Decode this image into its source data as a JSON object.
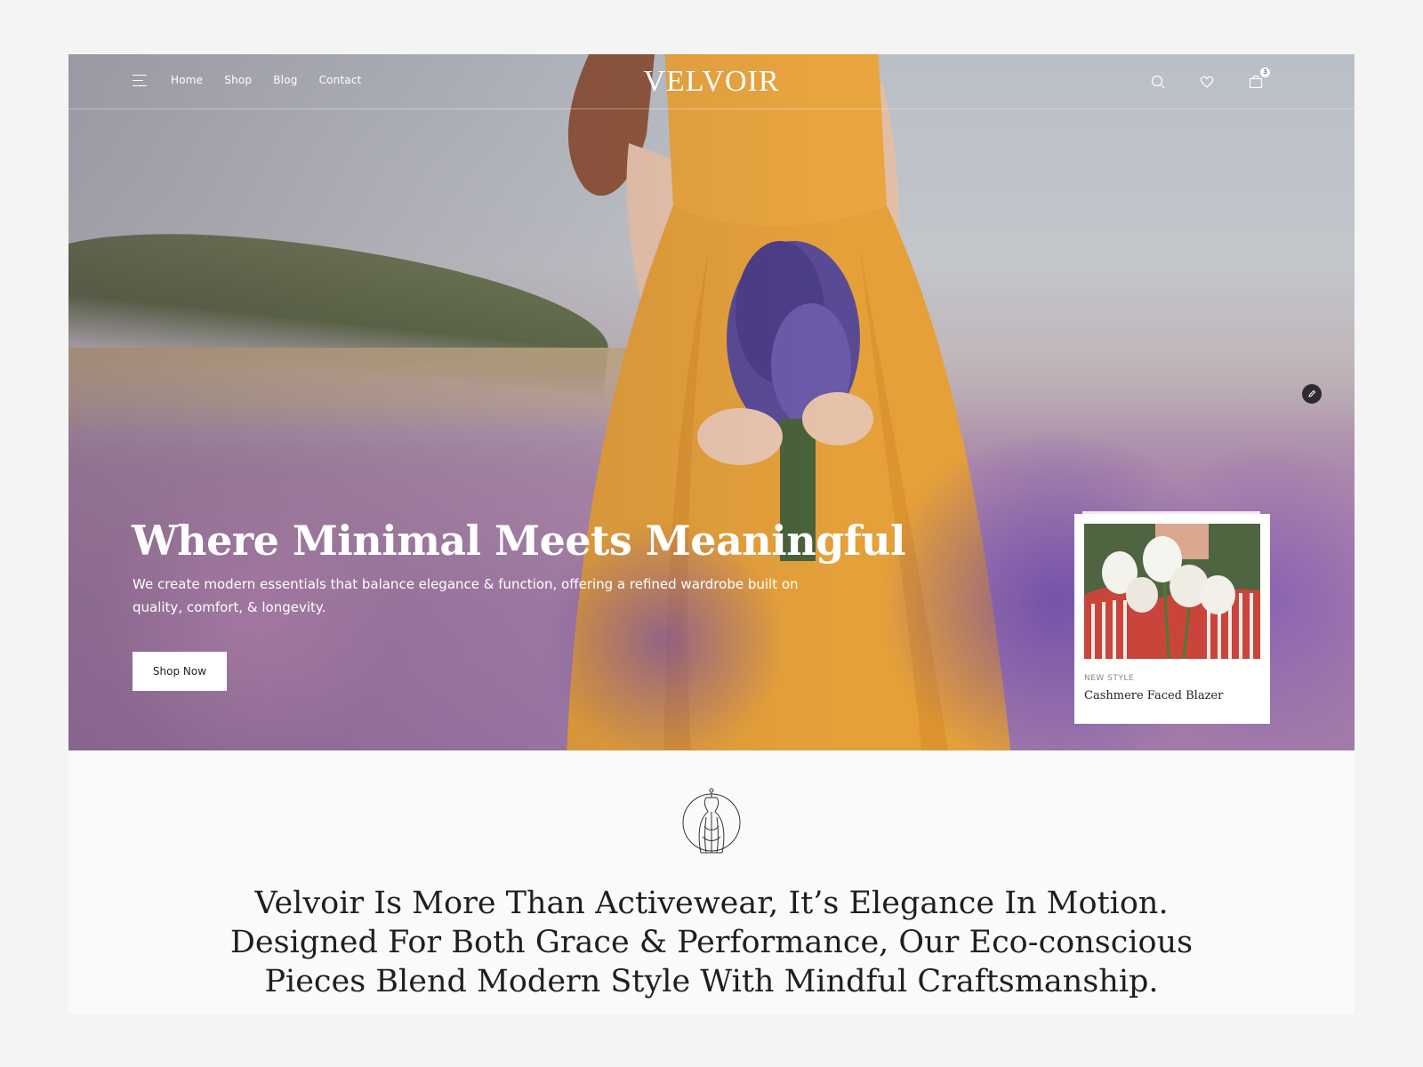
{
  "brand": {
    "logo": "VELVOIR"
  },
  "nav": {
    "links": [
      "Home",
      "Shop",
      "Blog",
      "Contact"
    ],
    "cart_count": "3"
  },
  "hero": {
    "title": "Where Minimal Meets Meaningful",
    "subtitle": "We create modern essentials that balance elegance & function, offering a refined wardrobe built on quality, comfort, & longevity.",
    "cta_label": "Shop Now"
  },
  "product_card": {
    "label": "NEW STYLE",
    "name": "Cashmere Faced  Blazer"
  },
  "mission": {
    "lines": [
      "Velvoir Is More Than Activewear, It’s Elegance In Motion.",
      "Designed For Both Grace & Performance, Our Eco-conscious",
      "Pieces Blend Modern Style With Mindful Craftsmanship."
    ]
  },
  "icons": {
    "menu": "hamburger-icon",
    "search": "search-icon",
    "wishlist": "heart-icon",
    "cart": "bag-icon",
    "edit": "pencil-icon",
    "emblem": "dress-form-icon"
  },
  "colors": {
    "background": "#f4f4f4",
    "content_bg": "#fafafa",
    "text_dark": "#1f1f1f",
    "white": "#ffffff",
    "dress": "#e4a13c",
    "lavender": "#6a4fa8"
  }
}
